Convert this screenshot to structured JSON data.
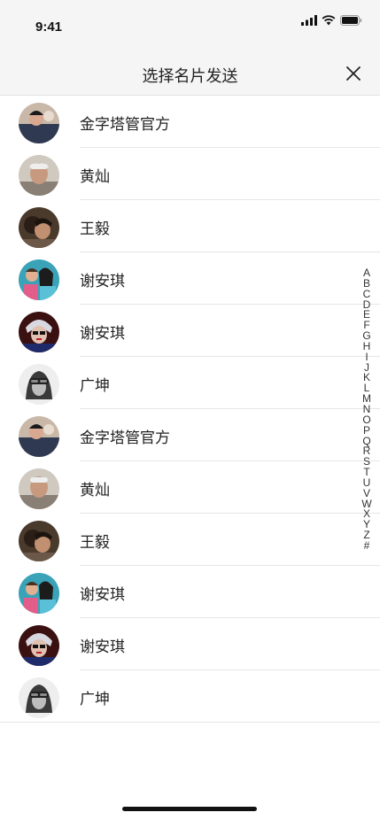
{
  "status_bar": {
    "time": "9:41"
  },
  "nav": {
    "title": "选择名片发送"
  },
  "contacts": [
    {
      "name": "金字塔管官方"
    },
    {
      "name": "黄灿"
    },
    {
      "name": "王毅"
    },
    {
      "name": "谢安琪"
    },
    {
      "name": "谢安琪"
    },
    {
      "name": "广坤"
    },
    {
      "name": "金字塔管官方"
    },
    {
      "name": "黄灿"
    },
    {
      "name": "王毅"
    },
    {
      "name": "谢安琪"
    },
    {
      "name": "谢安琪"
    },
    {
      "name": "广坤"
    }
  ],
  "index_letters": [
    "A",
    "B",
    "C",
    "D",
    "E",
    "F",
    "G",
    "H",
    "I",
    "J",
    "K",
    "L",
    "M",
    "N",
    "O",
    "P",
    "Q",
    "R",
    "S",
    "T",
    "U",
    "V",
    "W",
    "X",
    "Y",
    "Z",
    "#"
  ]
}
